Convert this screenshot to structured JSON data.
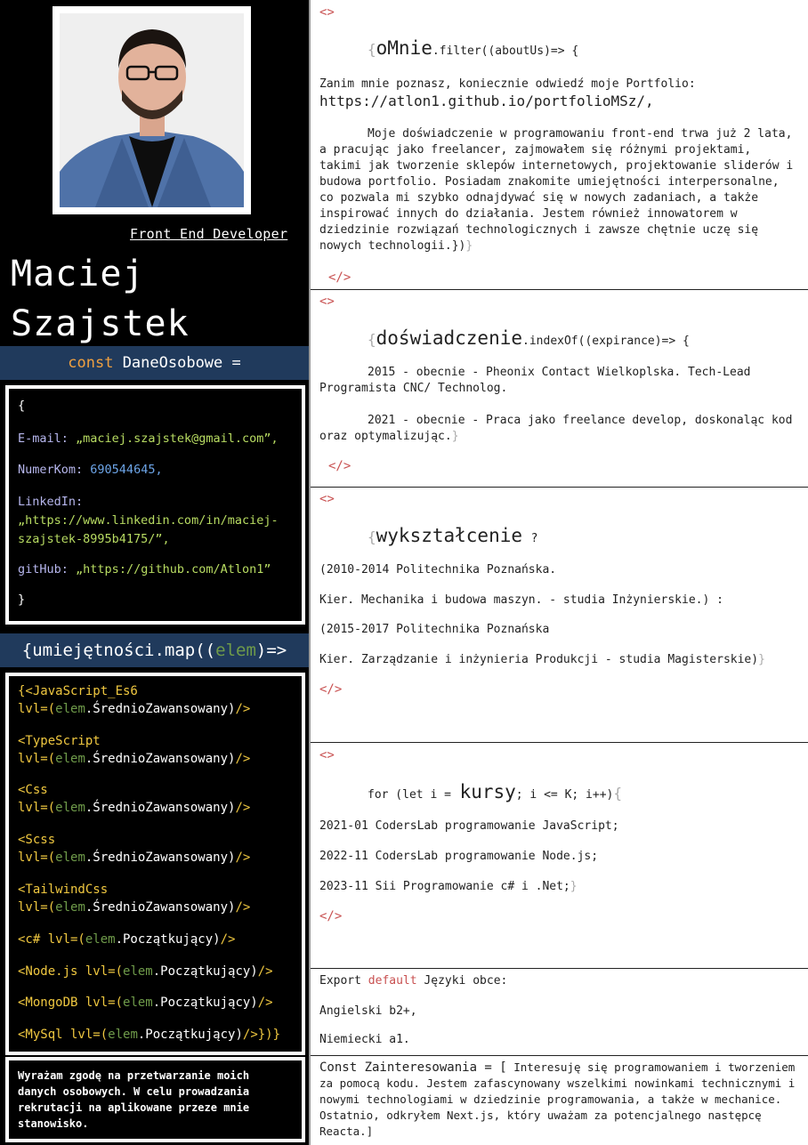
{
  "profile": {
    "role": "Front End Developer",
    "first_name": "Maciej",
    "last_name": "Szajstek"
  },
  "personal": {
    "band_keyword": "const",
    "band_name": "DaneOsobowe =",
    "open_brace": "{",
    "close_brace": "}",
    "email_key": "E-mail:",
    "email_value": "„maciej.szajstek@gmail.com”,",
    "phone_key": "NumerKom:",
    "phone_value": "690544645,",
    "linkedin_key": "LinkedIn:",
    "linkedin_value_line1": "„https://www.linkedin.com/in/maciej-",
    "linkedin_value_line2": "szajstek-8995b4175/”,",
    "github_key": "gitHub:",
    "github_value": "„https://github.com/Atlon1”"
  },
  "skills": {
    "band_prefix": "{umiejętności.map((",
    "band_elem": "elem",
    "band_suffix": ")=>",
    "items": [
      {
        "open": "{<JavaScript_Es6",
        "lvl": "lvl=(",
        "elem": "elem",
        "level": ".ŚrednioZawansowany)",
        "close": "/>"
      },
      {
        "open": "<TypeScript",
        "lvl": "lvl=(",
        "elem": "elem",
        "level": ".ŚrednioZawansowany)",
        "close": "/>"
      },
      {
        "open": "<Css",
        "lvl": "lvl=(",
        "elem": "elem",
        "level": ".ŚrednioZawansowany)",
        "close": "/>"
      },
      {
        "open": "<Scss",
        "lvl": "lvl=(",
        "elem": "elem",
        "level": ".ŚrednioZawansowany)",
        "close": "/>"
      },
      {
        "open": "<TailwindCss",
        "lvl": "lvl=(",
        "elem": "elem",
        "level": ".ŚrednioZawansowany)",
        "close": "/>"
      },
      {
        "open": "<c# lvl=(",
        "elem": "elem",
        "level": ".Początkujący)",
        "close": "/>"
      },
      {
        "open": "<Node.js lvl=(",
        "elem": "elem",
        "level": ".Początkujący)",
        "close": "/>"
      },
      {
        "open": "<MongoDB lvl=(",
        "elem": "elem",
        "level": ".Początkujący)",
        "close": "/>"
      },
      {
        "open": "<MySql lvl=(",
        "elem": "elem",
        "level": ".Początkujący)",
        "close": "/>})}"
      }
    ]
  },
  "consent": "Wyrażam zgodę na przetwarzanie moich danych osobowych. W celu prowadzania rekrutacji na aplikowane przeze mnie stanowisko.",
  "about": {
    "open_tag": "<>",
    "close_tag": "</>",
    "brace": "{",
    "title": "oMnie",
    "method": ".filter((aboutUs)=> {",
    "intro": "Zanim mnie poznasz, koniecznie odwiedź moje Portfolio:",
    "link": "https://atlon1.github.io/portfolioMSz/,",
    "body": "Moje doświadczenie w programowaniu front-end trwa już 2 lata, a pracując jako freelancer, zajmowałem się różnymi projektami, takimi jak tworzenie sklepów internetowych, projektowanie sliderów i budowa portfolio. Posiadam znakomite umiejętności interpersonalne, co pozwala mi szybko odnajdywać się w nowych zadaniach, a także inspirować innych do działania. Jestem również innowatorem w dziedzinie rozwiązań technologicznych i zawsze chętnie uczę się nowych technologii.})",
    "end": "}"
  },
  "experience": {
    "open_tag": "<>",
    "close_tag": "</>",
    "brace": "{",
    "title": "doświadczenie",
    "method": ".indexOf((expirance)=> {",
    "item1": "2015 - obecnie - Pheonix Contact Wielkoplska. Tech-Lead Programista CNC/ Technolog.",
    "item2": "2021 - obecnie - Praca jako freelance develop, doskonaląc kod oraz optymalizując.",
    "end": "}"
  },
  "education": {
    "open_tag": "<>",
    "close_tag": "</>",
    "brace": "{",
    "title": "wykształcenie",
    "suffix": "?",
    "line1": "(2010-2014 Politechnika Poznańska.",
    "line2": "Kier. Mechanika i budowa maszyn. - studia Inżynierskie.) :",
    "line3": "(2015-2017 Politechnika Poznańska",
    "line4": "Kier. Zarządzanie i inżynieria Produkcji - studia Magisterskie)",
    "end": "}"
  },
  "courses": {
    "open_tag": "<>",
    "close_tag": "</>",
    "prefix": "for (let i =",
    "title": "kursy",
    "suffix": "; i <= K; i++)",
    "brace": "{",
    "line1": "2021-01 CodersLab programowanie JavaScript;",
    "line2": "2022-11 CodersLab programowanie Node.js;",
    "line3": "2023-11 Sii Programowanie c# i .Net;",
    "end": "}"
  },
  "languages": {
    "export": "Export",
    "default": "default",
    "title": "Języki obce:",
    "line1": "Angielski b2+,",
    "line2": "Niemiecki a1."
  },
  "interests": {
    "lead": "Const Zainteresowania = [",
    "body": "Interesuję się programowaniem i tworzeniem za pomocą kodu. Jestem zafascynowany wszelkimi nowinkami technicznymi i nowymi technologiami w dziedzinie programowania, a także w mechanice. Ostatnio, odkryłem Next.js, który uważam za potencjalnego następcę Reacta.]"
  },
  "colors": {
    "left_background": "#000000",
    "band_background": "#203a5c",
    "keyword_orange": "#f0a040",
    "string_green": "#b8dc62",
    "number_blue": "#6da5e8",
    "skill_yellow": "#f0c840",
    "tag_red": "#c85050"
  }
}
